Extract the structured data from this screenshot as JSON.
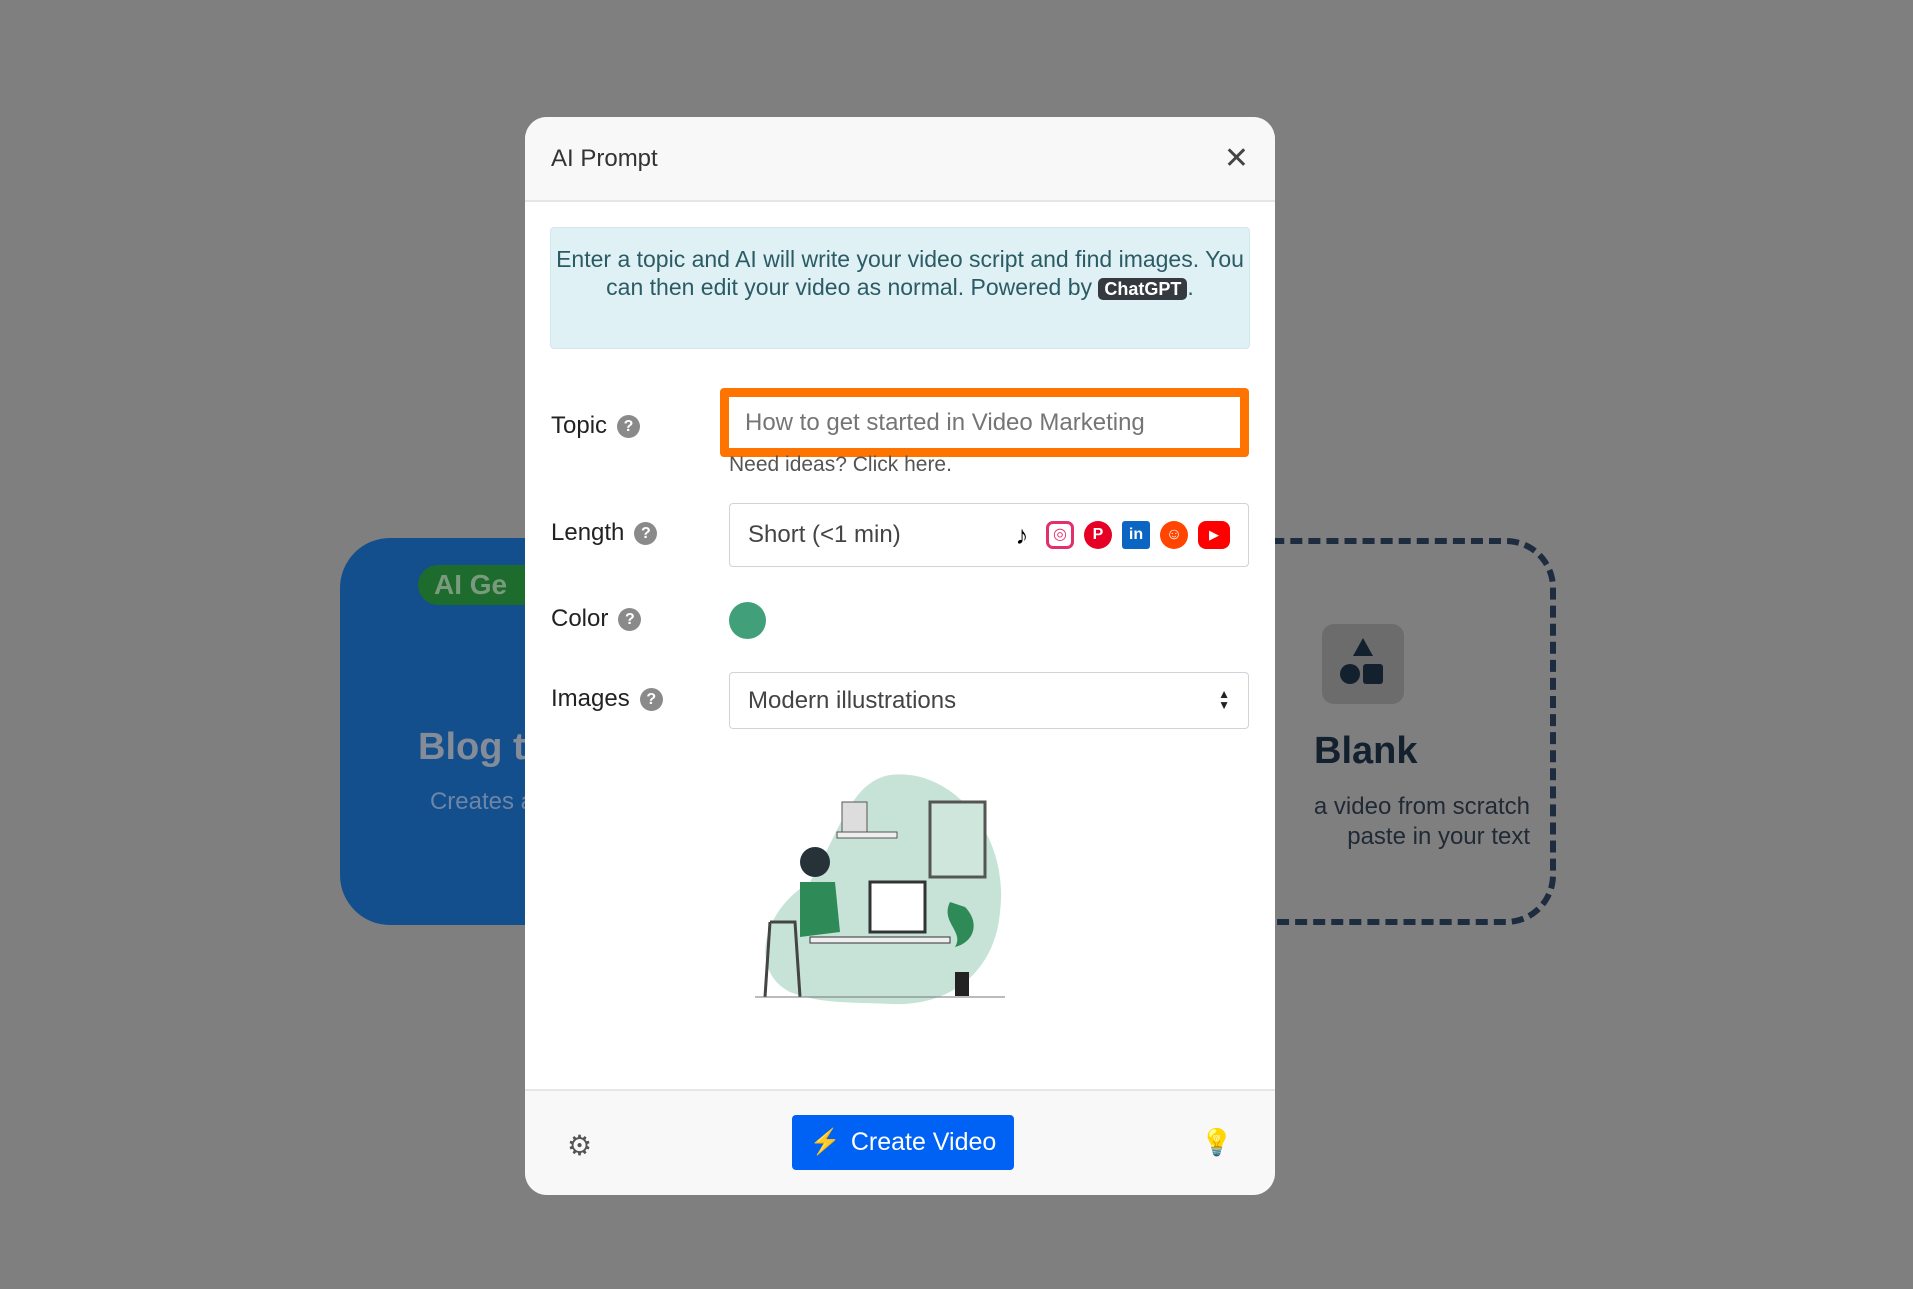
{
  "background": {
    "left_card": {
      "badge": "AI Ge",
      "title": "Blog t",
      "desc": "Creates a te your b"
    },
    "right_card": {
      "title": "Blank",
      "desc_line1": "a video from scratch",
      "desc_line2": "paste in your text"
    }
  },
  "modal": {
    "title": "AI Prompt",
    "info": {
      "text": "Enter a topic and AI will write your video script and find images. You can then edit your video as normal. Powered by",
      "badge": "ChatGPT",
      "end": "."
    },
    "topic": {
      "label": "Topic",
      "placeholder": "How to get started in Video Marketing",
      "hint": "Need ideas? Click here."
    },
    "length": {
      "label": "Length",
      "value": "Short (<1 min)",
      "platforms": [
        "tiktok",
        "instagram",
        "pinterest",
        "linkedin",
        "reddit",
        "youtube"
      ]
    },
    "color": {
      "label": "Color",
      "value": "#41a07a"
    },
    "images": {
      "label": "Images",
      "value": "Modern illustrations"
    },
    "footer": {
      "create_label": "Create Video"
    }
  },
  "colors": {
    "accent": "#0062f5",
    "highlight": "#ff7300"
  }
}
